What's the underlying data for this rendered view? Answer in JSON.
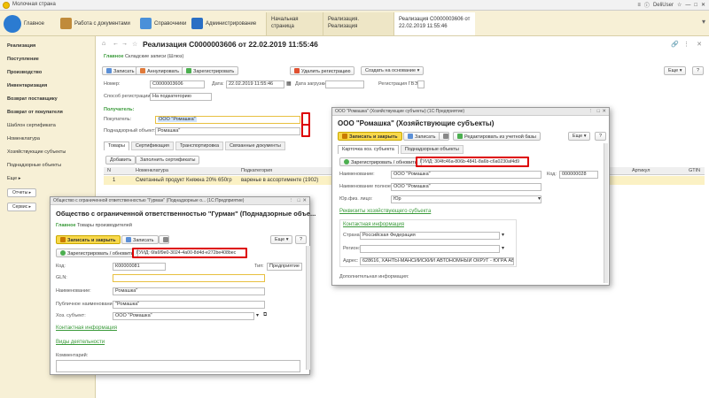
{
  "window": {
    "title": "Молочная страна",
    "user": "DeliUser",
    "controls": [
      "≡",
      "ⓘ",
      "☆",
      "—",
      "□",
      "✕"
    ]
  },
  "topnav": {
    "main": "Главное",
    "docs": "Работа с документами",
    "refs": "Справочники",
    "admin": "Администрирование",
    "tabs": [
      "Начальная страница",
      "Реализация. Реализация",
      "Реализация С0000003606 от\n22.02.2019 11:55:46"
    ]
  },
  "left": {
    "items": [
      {
        "label": "Реализация",
        "bold": true
      },
      {
        "label": "Поступление",
        "bold": true
      },
      {
        "label": "Производство",
        "bold": true
      },
      {
        "label": "Инвентаризация",
        "bold": true
      },
      {
        "label": "Возврат поставщику",
        "bold": true
      },
      {
        "label": "Возврат от покупателя",
        "bold": true
      },
      {
        "label": "Шаблон сертификата",
        "bold": false
      },
      {
        "label": "Номенклатура",
        "bold": false
      },
      {
        "label": "Хозяйствующие субъекты",
        "bold": false
      },
      {
        "label": "Поднадзорные объекты",
        "bold": false
      },
      {
        "label": "Еще ▸",
        "bold": false
      }
    ],
    "btn_reports": "Отчеты ▸",
    "btn_service": "Сервис ▸"
  },
  "doc": {
    "title": "Реализация С0000003606 от 22.02.2019 11:55:46",
    "nav_main": "Главное",
    "nav_stock": "Складские записи (Шлюз)",
    "toolbar": {
      "save": "Записать",
      "cancel": "Аннулировать",
      "register": "Зарегистрировать",
      "del_reg": "Удалить регистрацию",
      "create_based": "Создать на основание ▾",
      "more": "Еще ▾",
      "help": "?"
    },
    "number_label": "Номер:",
    "number": "С0000003606",
    "date_label": "Дата:",
    "date": "22.02.2019 11:55:46",
    "load_label": "Дата загрузки:",
    "gvz_label": "Регистрация ГВЭ:",
    "reg_method_label": "Способ регистрации:",
    "reg_method": "На подкатегорию",
    "receiver_link": "Получатель:",
    "buyer_label": "Покупатель:",
    "buyer": "ООО \"Ромашка\"",
    "obj_label": "Поднадзорный объект:",
    "obj": "Ромашка\"",
    "tabs": [
      "Товары",
      "Сертификация",
      "Транспортировка",
      "Связанные документы"
    ],
    "add": "Добавить",
    "fill_cert": "Заполнить сертификаты",
    "cols": [
      "N",
      "Номенклатура",
      "Подкатегория",
      "Артикул",
      "GTIN"
    ],
    "row": {
      "n": "1",
      "name": "Сметанный продукт Княжна 20% 650гр",
      "sub": "варенье в ассортименте (1902)"
    }
  },
  "dlg2": {
    "title": "Общество с ограниченной ответственностью \"Гурман\" (Поднадзорные о... (1С:Предприятие)",
    "head": "Общество с ограниченной ответственностью \"Гурман\" (Поднадзорные объе...",
    "nav_main": "Главное",
    "nav_goods": "Товары производителей",
    "save_close": "Записать и закрыть",
    "save": "Записать",
    "more": "Еще ▾",
    "help": "?",
    "reg": "Зарегистрировать / обновить",
    "guid": "ГУИД: 6fa6f9e0-3024-4a00-8d4d-e272be408bec",
    "code_label": "Код:",
    "code": "К00000081",
    "type_label": "Тип:",
    "type": "Предприятие",
    "gln_label": "GLN:",
    "name_label": "Наименование:",
    "name": "Ромашка\"",
    "public_label": "Публичное наименование:",
    "public": "\"Ромашка\"",
    "subj_label": "Хоз. субъект:",
    "subj": "ООО \"Ромашка\"",
    "contact": "Контактная информация",
    "activities": "Виды деятельности",
    "comment": "Комментарий:"
  },
  "dlg1": {
    "title": "ООО \"Ромашка\" (Хозяйствующие субъекты) (1С:Предприятие)",
    "head": "ООО \"Ромашка\" (Хозяйствующие субъекты)",
    "save_close": "Записать и закрыть",
    "save": "Записать",
    "redirect": "Редактировать из учетной базы",
    "more": "Еще ▾",
    "help": "?",
    "tabs": [
      "Карточка хоз. субъекта",
      "Поднадзорные объекты"
    ],
    "reg": "Зарегистрировать / обновить",
    "guid": "ГУИД: 304fc46a-806b-4841-8a6b-c6a0230af4d9",
    "name_label": "Наименование:",
    "name": "ООО \"Ромашка\"",
    "code_label": "Код:",
    "code": "000000028",
    "fullname_label": "Наименование полное:",
    "fullname": "ООО \"Ромашка\"",
    "ur_label": "Юр.физ. лицо:",
    "ur": "Юр",
    "req_link": "Реквизиты хозяйствующего субъекта",
    "contact": "Контактная информация",
    "country_label": "Страна:",
    "country": "Российская Федерация",
    "region_label": "Регион:",
    "address_label": "Адрес:",
    "address": "628616, ХАНТЫ-МАНСИЙСКИЙ АВТОНОМНЫЙ ОКРУГ - ЮГРА АВТ",
    "extra": "Дополнительная информация:"
  },
  "colors": {
    "accent": "#f8d84a",
    "link": "#3a9a3a",
    "panel": "#f7f0d6",
    "red": "#dd0000"
  }
}
